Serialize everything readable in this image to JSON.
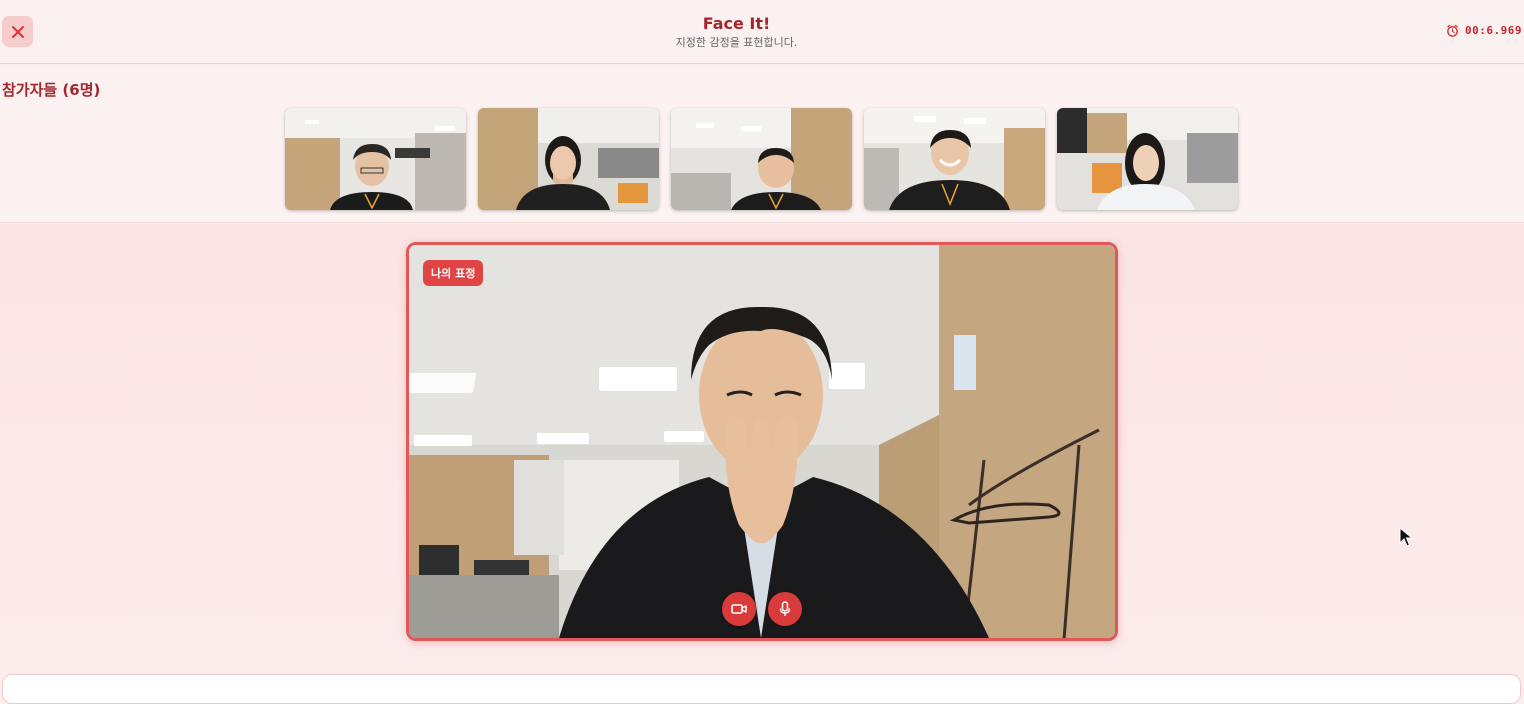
{
  "header": {
    "title": "Face It!",
    "subtitle": "지정한 감정을 표현합니다.",
    "close_icon": "close-icon",
    "timer_icon": "alarm-clock-icon",
    "timer": "00:6.969"
  },
  "participants": {
    "title": "참가자들 (6명)",
    "thumbnails": [
      {
        "name": "participant-1"
      },
      {
        "name": "participant-2"
      },
      {
        "name": "participant-3"
      },
      {
        "name": "participant-4"
      },
      {
        "name": "participant-5"
      }
    ]
  },
  "main_video": {
    "badge": "나의 표정",
    "camera_icon": "video-camera-icon",
    "mic_icon": "microphone-icon"
  },
  "colors": {
    "accent": "#d93b3b",
    "title": "#a4262c",
    "background": "#fbeeee"
  }
}
